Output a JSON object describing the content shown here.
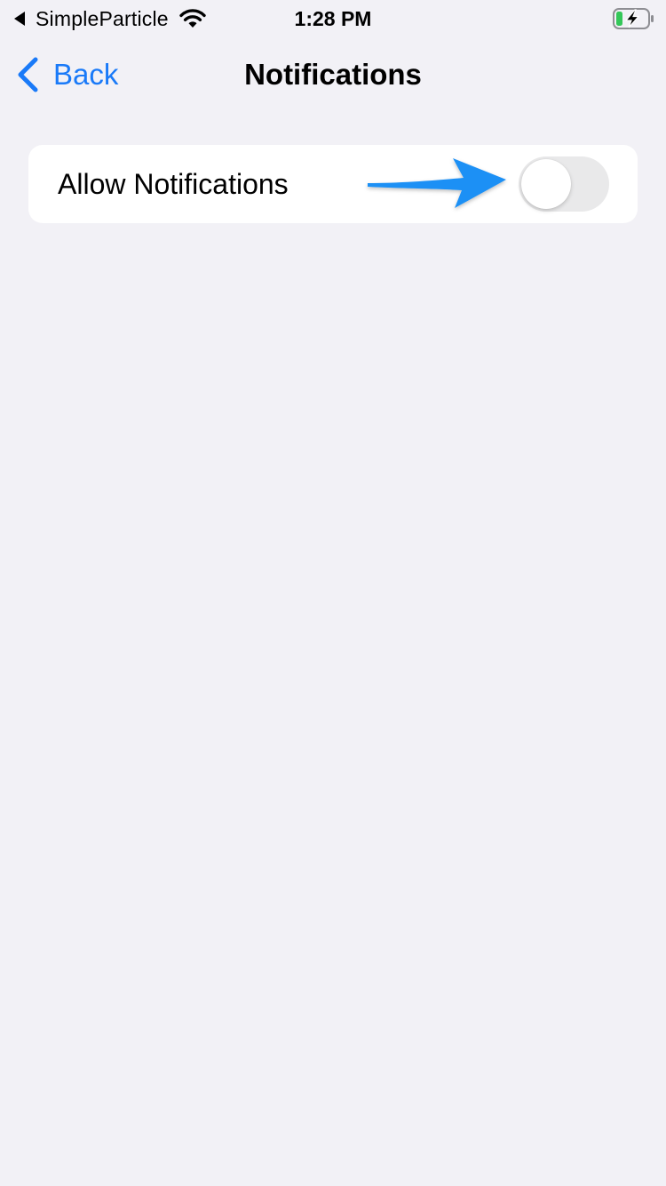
{
  "status_bar": {
    "back_app": "SimpleParticle",
    "time": "1:28 PM",
    "icons": [
      "back-to-app-icon",
      "wifi-icon",
      "battery-charging-icon"
    ]
  },
  "nav": {
    "back_label": "Back",
    "title": "Notifications"
  },
  "settings": {
    "allow_notifications_label": "Allow Notifications",
    "allow_notifications_on": false
  },
  "colors": {
    "accent": "#1a7af8",
    "background": "#f2f1f6",
    "toggle_off": "#e9e9ea",
    "annotation_arrow": "#1e90f5",
    "battery_fill": "#34c759"
  }
}
